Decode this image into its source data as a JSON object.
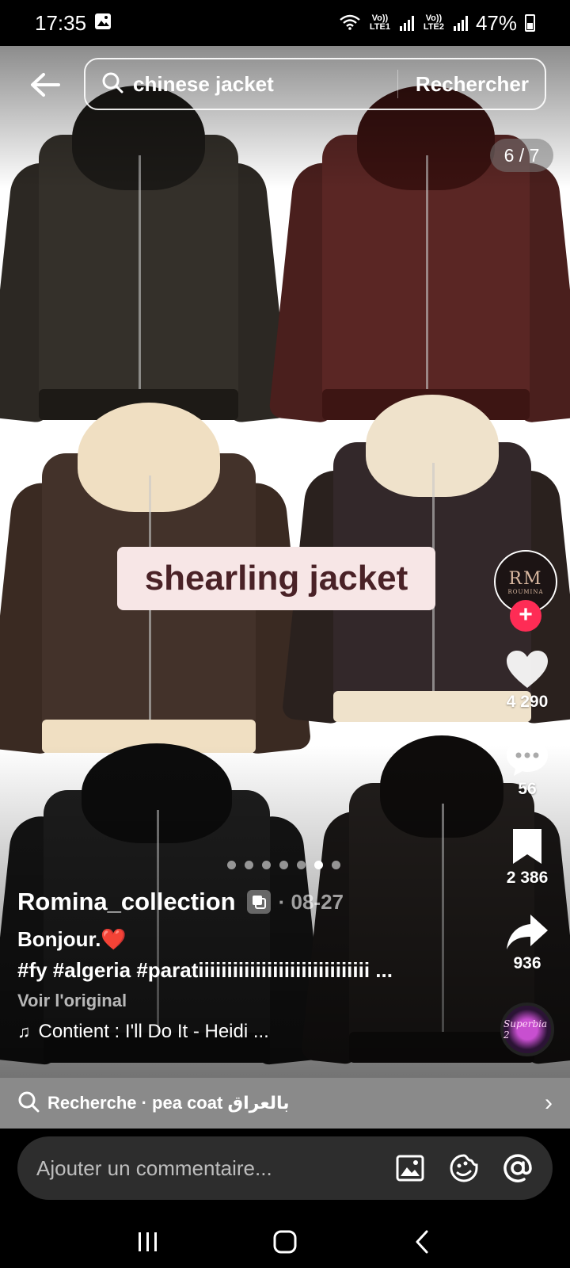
{
  "status_bar": {
    "time": "17:35",
    "sim1_label": "Vo)) LTE1",
    "sim2_label": "Vo)) LTE2",
    "battery": "47%"
  },
  "search": {
    "query": "chinese jacket",
    "button_label": "Rechercher"
  },
  "carousel": {
    "counter": "6 / 7",
    "overlay_text": "shearling jacket",
    "total_slides": 7,
    "active_slide": 6
  },
  "rail": {
    "avatar_monogram": "RM",
    "avatar_brand": "ROUMINA",
    "likes": "4 290",
    "comments": "56",
    "saves": "2 386",
    "shares": "936",
    "music_disc_label": "Superbia 2"
  },
  "post": {
    "author": "Romina_collection",
    "date": "· 08-27",
    "description": "Bonjour.❤️",
    "hashtags": "#fy #algeria #paratiiiiiiiiiiiiiiiiiiiiiiiiiiiiii ...",
    "translate_label": "Voir l'original",
    "music": "Contient : I'll Do It - Heidi ..."
  },
  "related_search": {
    "text": "Recherche · pea coat بالعراق"
  },
  "comment": {
    "placeholder": "Ajouter un commentaire..."
  },
  "colors": {
    "accent": "#fe2c55",
    "overlay_bg": "#f7e6e6",
    "overlay_text": "#4a2227"
  }
}
